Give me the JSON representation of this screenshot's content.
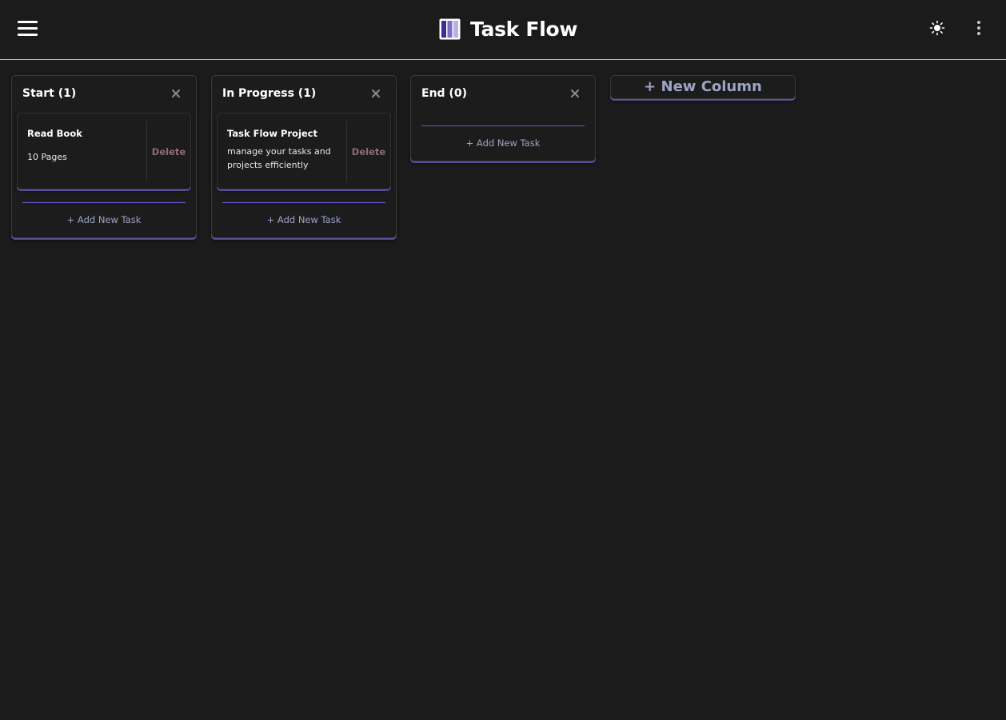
{
  "app": {
    "title": "Task Flow",
    "logo_icon": "kanban-columns-icon",
    "menu_icon": "hamburger-menu-icon",
    "theme_icon": "sun-icon",
    "more_icon": "more-vertical-icon"
  },
  "colors": {
    "background": "#1b1b1b",
    "accent": "#6956c2",
    "delete_text": "#8b6d72",
    "muted_text": "#9ea3c4"
  },
  "board": {
    "columns": [
      {
        "title": "Start (1)",
        "close_icon": "close-icon",
        "tasks": [
          {
            "title": "Read Book",
            "description": "10 Pages",
            "delete_label": "Delete"
          }
        ],
        "add_label": "+ Add New Task"
      },
      {
        "title": "In Progress (1)",
        "close_icon": "close-icon",
        "tasks": [
          {
            "title": "Task Flow Project",
            "description": "manage your tasks and projects efficiently",
            "delete_label": "Delete"
          }
        ],
        "add_label": "+ Add New Task"
      },
      {
        "title": "End (0)",
        "close_icon": "close-icon",
        "tasks": [],
        "add_label": "+ Add New Task"
      }
    ],
    "new_column_label": "+ New Column"
  }
}
